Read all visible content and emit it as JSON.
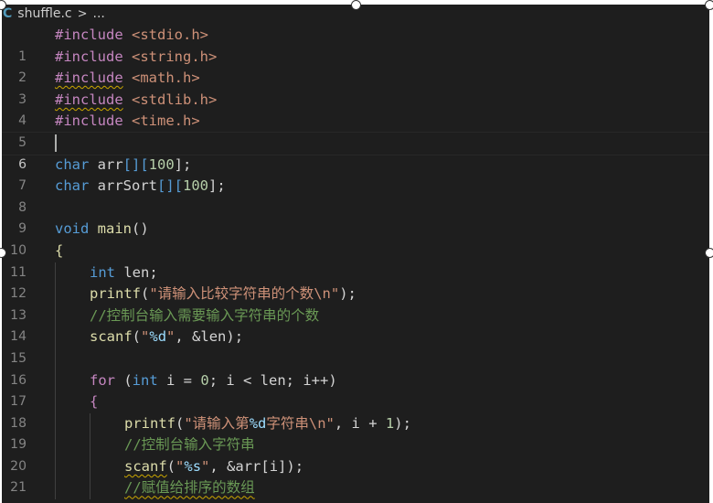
{
  "breadcrumb": {
    "file_icon": "C",
    "file_name": "shuffle.c",
    "separator": ">",
    "more": "..."
  },
  "code": {
    "l1": {
      "n": "1",
      "a": "#include",
      "b": "<stdio.h>"
    },
    "l2": {
      "n": "2",
      "a": "#include",
      "b": "<string.h>"
    },
    "l3": {
      "n": "3",
      "a": "#include",
      "b": "<math.h>"
    },
    "l4": {
      "n": "4",
      "a": "#include",
      "b": "<stdlib.h>"
    },
    "l5": {
      "n": "5",
      "a": "#include",
      "b": "<time.h>"
    },
    "l6": {
      "n": "6"
    },
    "l7": {
      "n": "7",
      "a": "char",
      "b": "arr",
      "c": "[][",
      "d": "100",
      "e": "];"
    },
    "l8": {
      "n": "8",
      "a": "char",
      "b": "arrSort",
      "c": "[][",
      "d": "100",
      "e": "];"
    },
    "l9": {
      "n": "9"
    },
    "l10": {
      "n": "10",
      "a": "void",
      "b": "main",
      "c": "()"
    },
    "l11": {
      "n": "11",
      "a": "{"
    },
    "l12": {
      "n": "12",
      "a": "int",
      "b": "len;"
    },
    "l13": {
      "n": "13",
      "a": "printf",
      "b": "(",
      "c": "\"请输入比较字符串的个数",
      "d": "\\n",
      "e": "\"",
      "f": ");"
    },
    "l14": {
      "n": "14",
      "a": "//控制台输入需要输入字符串的个数"
    },
    "l15": {
      "n": "15",
      "a": "scanf",
      "b": "(",
      "c": "\"",
      "d": "%d",
      "e": "\"",
      "f": ", &len);"
    },
    "l16": {
      "n": "16"
    },
    "l17": {
      "n": "17",
      "a": "for",
      "b": " (",
      "c": "int",
      "d": " i = ",
      "e": "0",
      "f": "; i < len; i++)"
    },
    "l18": {
      "n": "18",
      "a": "{"
    },
    "l19": {
      "n": "19",
      "a": "printf",
      "b": "(",
      "c": "\"请输入第",
      "d": "%d",
      "e": "字符串",
      "f": "\\n",
      "g": "\"",
      "h": ", i + ",
      "i": "1",
      "j": ");"
    },
    "l20": {
      "n": "20",
      "a": "//控制台输入字符串"
    },
    "l21": {
      "n": "21",
      "a": "scanf",
      "b": "(",
      "c": "\"",
      "d": "%s",
      "e": "\"",
      "f": ", &arr[i]);"
    },
    "l22": {
      "n": "22",
      "a": "//赋值给排序的数组"
    }
  },
  "colors": {
    "editor_background": "#1e1e1e",
    "keyword": "#569cd6",
    "preprocessor": "#c586c0",
    "string": "#ce9178",
    "number": "#b5cea8",
    "function": "#dcdcaa",
    "comment": "#6a9955",
    "format_specifier": "#9cdcfe",
    "squiggle_warning": "#cca700"
  },
  "icons": {
    "file_icon": "c-language-file-icon",
    "cursor": "text-cursor"
  },
  "cursor_line": "6"
}
